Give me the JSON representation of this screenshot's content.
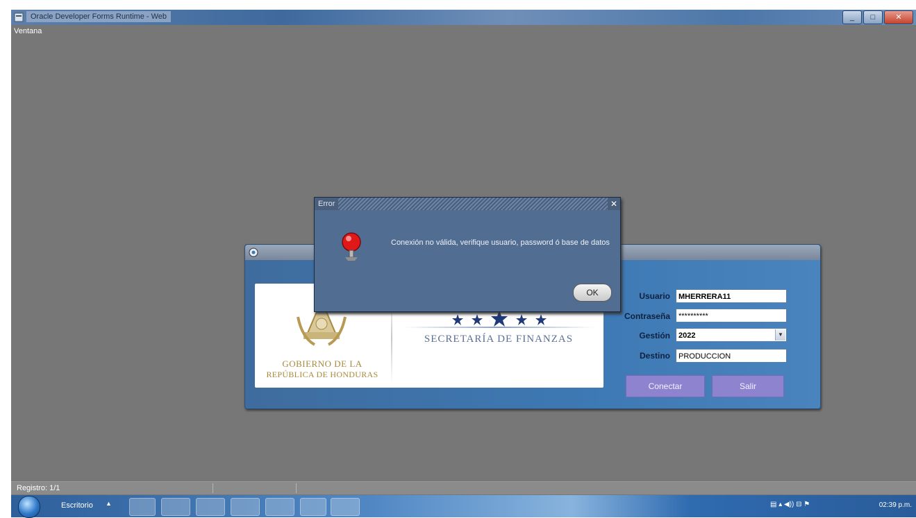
{
  "window": {
    "title": "Oracle Developer Forms Runtime - Web",
    "min": "_",
    "max": "□",
    "close": "✕"
  },
  "menu": {
    "items": [
      "Ventana"
    ]
  },
  "login": {
    "title": "",
    "banner": {
      "secretaria": "SECRETARÍA DE FINANZAS",
      "gobierno_line1": "GOBIERNO DE LA",
      "gobierno_line2": "REPÚBLICA DE HONDURAS"
    },
    "fields": {
      "usuario_label": "Usuario",
      "usuario_value": "MHERRERA11",
      "contrasena_label": "Contraseña",
      "contrasena_value": "**********",
      "gestion_label": "Gestión",
      "gestion_value": "2022",
      "destino_label": "Destino",
      "destino_value": "PRODUCCION"
    },
    "buttons": {
      "conectar": "Conectar",
      "salir": "Salir"
    }
  },
  "error_dialog": {
    "title": "Error",
    "message": "Conexión no válida, verifique usuario, password ó base de datos",
    "ok_label": "OK"
  },
  "status": {
    "record": "Registro: 1/1"
  },
  "taskbar": {
    "desktop_label": "Escritorio",
    "clock": "02:39 p.m."
  },
  "colors": {
    "workspace": "#777777",
    "login_panel": "#3d79b4",
    "buttons": "#8e83cf",
    "error_dialog": "#516d92"
  }
}
